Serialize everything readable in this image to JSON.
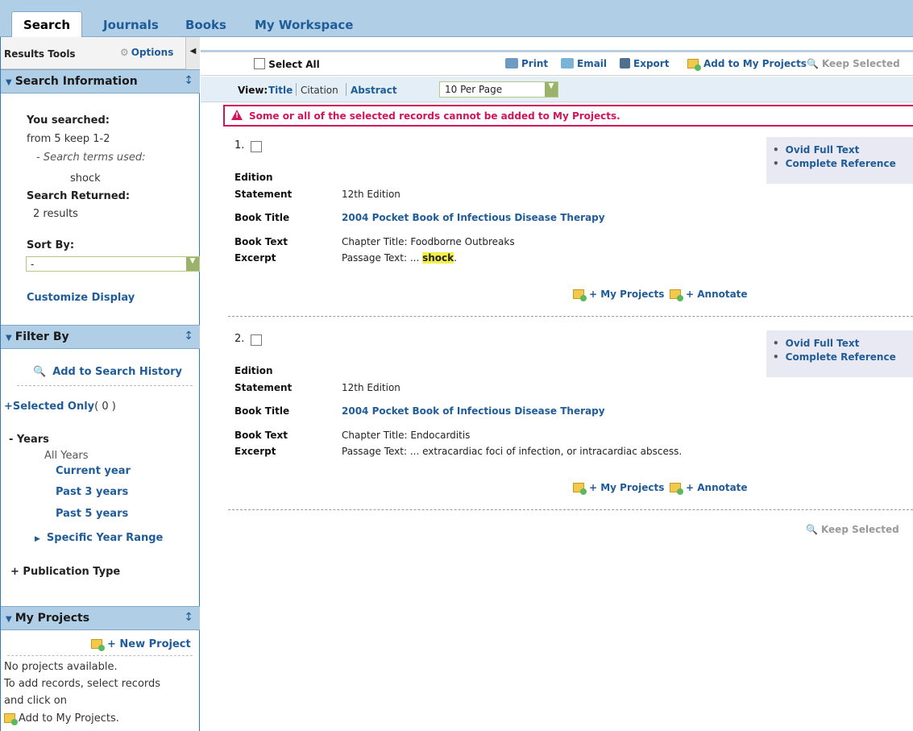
{
  "nav": {
    "tabs": [
      {
        "label": "Search",
        "active": true
      },
      {
        "label": "Journals",
        "active": false
      },
      {
        "label": "Books",
        "active": false
      },
      {
        "label": "My Workspace",
        "active": false
      }
    ]
  },
  "sidebar": {
    "results_tools": "Results Tools",
    "options": "Options",
    "search_info": {
      "header": "Search Information",
      "you_searched": "You searched:",
      "query": "from 5 keep 1-2",
      "terms_label": "- Search terms used:",
      "term": "shock",
      "returned_label": "Search Returned:",
      "returned_value": "2 results",
      "sort_label": "Sort By:",
      "sort_value": "-",
      "customize": "Customize Display"
    },
    "filter": {
      "header": "Filter By",
      "add_history": "Add to Search History",
      "selected_only": "+Selected Only",
      "selected_count": "( 0 )",
      "years_label": "- Years",
      "all_years": "All Years",
      "year_options": [
        "Current year",
        "Past 3 years",
        "Past 5 years"
      ],
      "specific_range": "Specific Year Range",
      "pub_type": "+ Publication Type"
    },
    "projects": {
      "header": "My Projects",
      "new_project": "+ New Project",
      "msg1": "No projects available.",
      "msg2": "To add records, select records",
      "msg3": "and click on",
      "msg4": "Add to My Projects."
    }
  },
  "toolbar": {
    "select_all": "Select All",
    "print": "Print",
    "email": "Email",
    "export": "Export",
    "add_projects": "Add to My Projects",
    "keep_selected": "Keep Selected"
  },
  "viewbar": {
    "view_label": "View:",
    "views": [
      "Title",
      "Citation",
      "Abstract"
    ],
    "per_page": "10 Per Page"
  },
  "alert": "Some or all of the selected records cannot be added to My Projects.",
  "labels": {
    "edition": "Edition",
    "statement": "Statement",
    "book_title": "Book Title",
    "book_text": "Book Text",
    "excerpt": "Excerpt",
    "ovid": "Ovid Full Text",
    "complete_ref": "Complete Reference",
    "my_projects": "+ My Projects",
    "annotate": "+ Annotate"
  },
  "records": [
    {
      "number": "1.",
      "edition": "12th Edition",
      "title": "2004 Pocket Book of Infectious Disease Therapy",
      "chapter": "Chapter Title: Foodborne Outbreaks",
      "passage_prefix": "Passage Text: ... ",
      "passage_highlight": "shock",
      "passage_suffix": "."
    },
    {
      "number": "2.",
      "edition": "12th Edition",
      "title": "2004 Pocket Book of Infectious Disease Therapy",
      "chapter": "Chapter Title: Endocarditis",
      "passage_prefix": "Passage Text: ... extracardiac foci of infection, or intracardiac abscess.",
      "passage_highlight": "",
      "passage_suffix": ""
    }
  ],
  "bottom_keep": "Keep Selected"
}
